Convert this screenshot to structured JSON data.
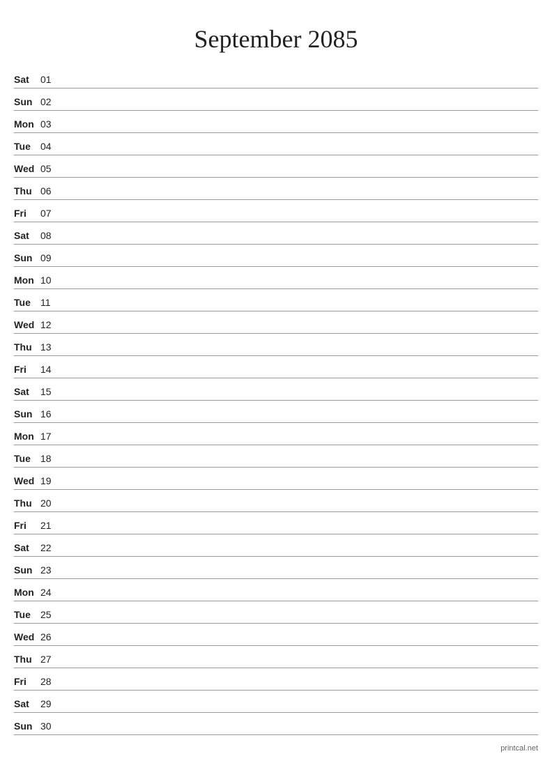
{
  "title": "September 2085",
  "footer": "printcal.net",
  "days": [
    {
      "name": "Sat",
      "num": "01"
    },
    {
      "name": "Sun",
      "num": "02"
    },
    {
      "name": "Mon",
      "num": "03"
    },
    {
      "name": "Tue",
      "num": "04"
    },
    {
      "name": "Wed",
      "num": "05"
    },
    {
      "name": "Thu",
      "num": "06"
    },
    {
      "name": "Fri",
      "num": "07"
    },
    {
      "name": "Sat",
      "num": "08"
    },
    {
      "name": "Sun",
      "num": "09"
    },
    {
      "name": "Mon",
      "num": "10"
    },
    {
      "name": "Tue",
      "num": "11"
    },
    {
      "name": "Wed",
      "num": "12"
    },
    {
      "name": "Thu",
      "num": "13"
    },
    {
      "name": "Fri",
      "num": "14"
    },
    {
      "name": "Sat",
      "num": "15"
    },
    {
      "name": "Sun",
      "num": "16"
    },
    {
      "name": "Mon",
      "num": "17"
    },
    {
      "name": "Tue",
      "num": "18"
    },
    {
      "name": "Wed",
      "num": "19"
    },
    {
      "name": "Thu",
      "num": "20"
    },
    {
      "name": "Fri",
      "num": "21"
    },
    {
      "name": "Sat",
      "num": "22"
    },
    {
      "name": "Sun",
      "num": "23"
    },
    {
      "name": "Mon",
      "num": "24"
    },
    {
      "name": "Tue",
      "num": "25"
    },
    {
      "name": "Wed",
      "num": "26"
    },
    {
      "name": "Thu",
      "num": "27"
    },
    {
      "name": "Fri",
      "num": "28"
    },
    {
      "name": "Sat",
      "num": "29"
    },
    {
      "name": "Sun",
      "num": "30"
    }
  ]
}
